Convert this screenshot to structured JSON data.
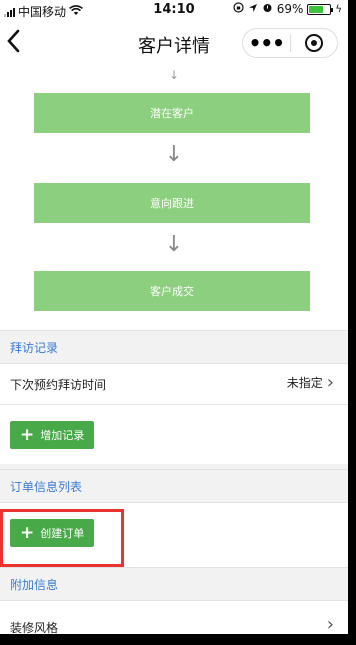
{
  "status_bar": {
    "carrier": "中国移动",
    "time": "14:10",
    "battery_percent": "69%",
    "battery_level": 0.69
  },
  "nav": {
    "title": "客户详情",
    "more_glyph": "•••"
  },
  "flow": {
    "steps": [
      {
        "label": "潜在客户"
      },
      {
        "label": "意向跟进"
      },
      {
        "label": "客户成交"
      }
    ]
  },
  "visit_section": {
    "header": "拜访记录",
    "next_visit_label": "下次预约拜访时间",
    "next_visit_value": "未指定",
    "add_button": "增加记录"
  },
  "order_section": {
    "header": "订单信息列表",
    "create_button": "创建订单"
  },
  "extra_section": {
    "header": "附加信息",
    "decor_style_label": "装修风格"
  },
  "colors": {
    "step_fill": "#8ccf7e",
    "button_green": "#47a947",
    "section_link_blue": "#3b7bd4",
    "highlight_red": "#e8332f"
  }
}
